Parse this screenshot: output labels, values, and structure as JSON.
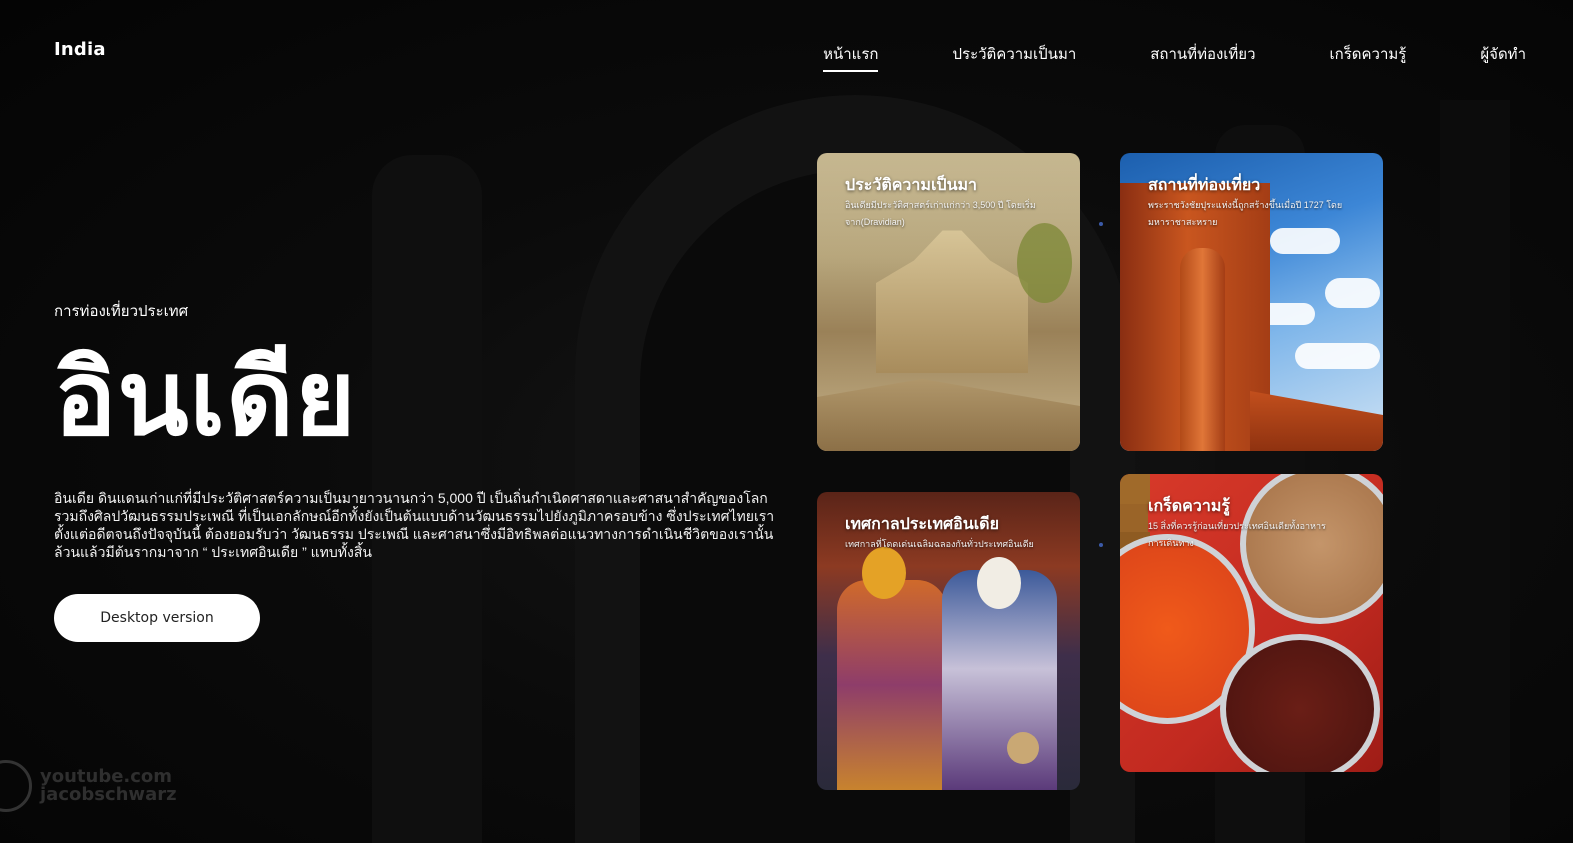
{
  "brand": "India",
  "nav": {
    "items": [
      {
        "label": "หน้าแรก",
        "active": true
      },
      {
        "label": "ประวัติความเป็นมา",
        "active": false
      },
      {
        "label": "สถานที่ท่องเที่ยว",
        "active": false
      },
      {
        "label": "เกร็ดความรู้",
        "active": false
      },
      {
        "label": "ผู้จัดทำ",
        "active": false
      }
    ]
  },
  "hero": {
    "eyebrow": "การท่องเที่ยวประเทศ",
    "title": "อินเดีย",
    "description": "อินเดีย ดินแดนเก่าแก่ที่มีประวัติศาสตร์ความเป็นมายาวนานกว่า 5,000 ปี เป็นถิ่นกำเนิดศาสดาและศาสนาสำคัญของโลก รวมถึงศิลปวัฒนธรรมประเพณี ที่เป็นเอกลักษณ์อีกทั้งยังเป็นต้นแบบด้านวัฒนธรรมไปยังภูมิภาครอบข้าง ซึ่งประเทศไทยเรา ตั้งแต่อดีตจนถึงปัจจุบันนี้ ต้องยอมรับว่า วัฒนธรรม ประเพณี และศาสนาซึ่งมีอิทธิพลต่อแนวทางการดำเนินชีวิตของเรานั้น ล้วนแล้วมีต้นรากมาจาก “ ประเทศอินเดีย ” แทบทั้งสิ้น",
    "cta": "Desktop version"
  },
  "cards": [
    {
      "title": "ประวัติความเป็นมา",
      "text": "อินเดียมีประวัติศาสตร์เก่าแก่กว่า 3,500 ปี โดยเริ่มจาก(Dravidian)"
    },
    {
      "title": "สถานที่ท่องเที่ยว",
      "text": "พระราชวังชัยปุระแห่งนี้ถูกสร้างขึ้นเมื่อปี 1727 โดยมหาราชาสะหราย"
    },
    {
      "title": "เทศกาลประเทศอินเดีย",
      "text": "เทศกาลที่โดดเด่นเฉลิมฉลองกันทั่วประเทศอินเดีย"
    },
    {
      "title": "เกร็ดความรู้",
      "text": "15 สิ่งที่ควรรู้ก่อนเที่ยวประเทศอินเดียทั้งอาหาร การเดินทาง"
    }
  ],
  "watermark": {
    "line1": "youtube.com",
    "line2": "jacobschwarz"
  }
}
